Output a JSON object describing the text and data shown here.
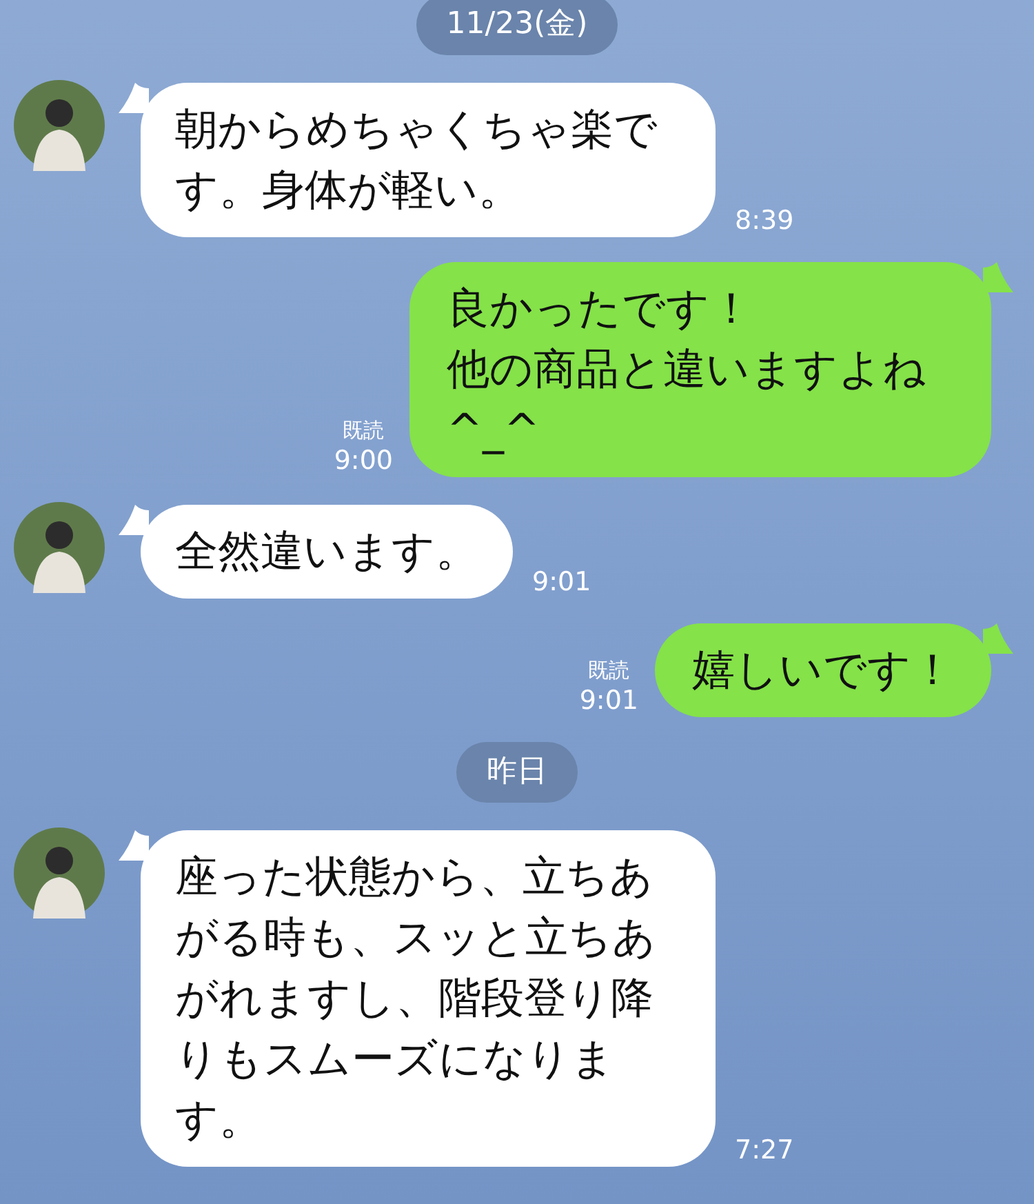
{
  "messages": [
    {
      "kind": "date",
      "text": "11/23(金)"
    },
    {
      "kind": "incoming",
      "text": "朝からめちゃくちゃ楽です。身体が軽い。",
      "time": "8:39"
    },
    {
      "kind": "outgoing",
      "lines": [
        "良かったです！",
        "他の商品と違いますよね^_^"
      ],
      "read": "既読",
      "time": "9:00"
    },
    {
      "kind": "incoming",
      "text": "全然違います。",
      "time": "9:01"
    },
    {
      "kind": "outgoing",
      "lines": [
        "嬉しいです！"
      ],
      "read": "既読",
      "time": "9:01"
    },
    {
      "kind": "date",
      "text": "昨日"
    },
    {
      "kind": "incoming",
      "text": "座った状態から、立ちあがる時も、スッと立ちあがれますし、階段登り降りもスムーズになります。",
      "time": "7:27"
    }
  ]
}
